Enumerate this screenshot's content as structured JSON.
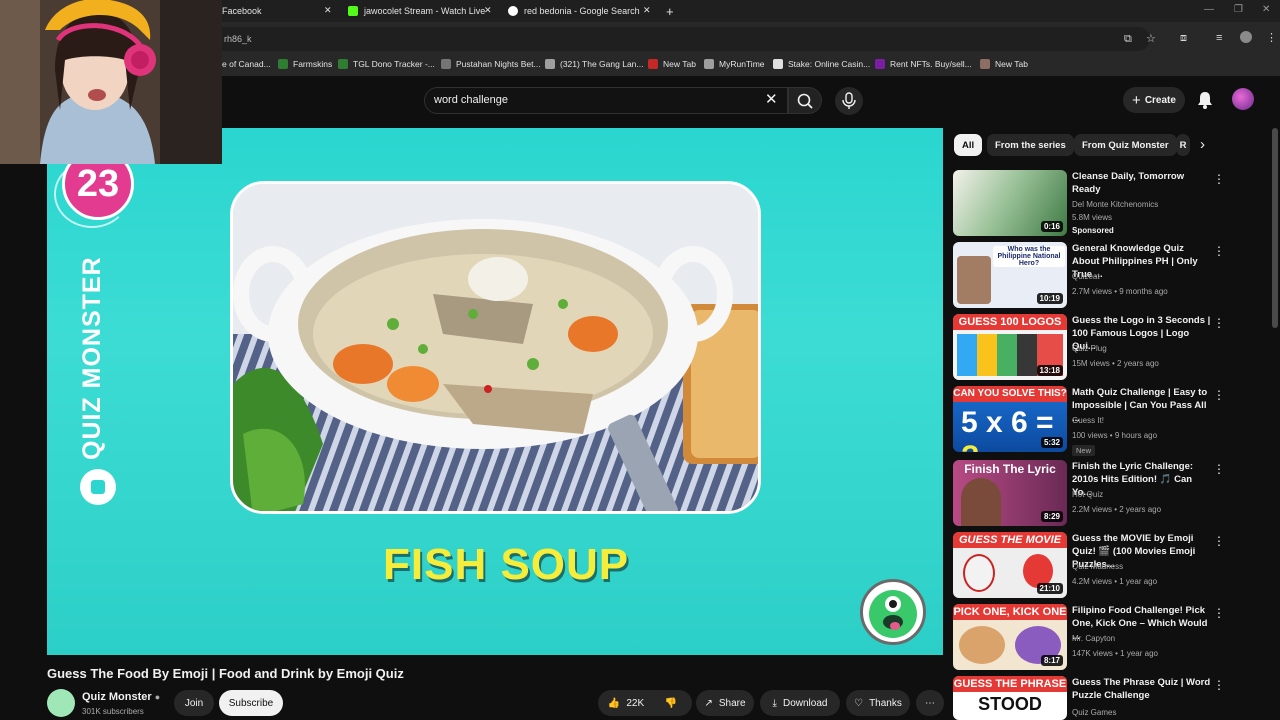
{
  "browser": {
    "tabs": [
      {
        "title": "Facebook",
        "color": "#1877f2"
      },
      {
        "title": "jawocolet Stream - Watch Live",
        "color": "#53fc18"
      },
      {
        "title": "red bedonia - Google Search",
        "color": "#4285f4"
      }
    ],
    "address": "rh86_k",
    "bookmarks": [
      {
        "label": "e of Canad...",
        "color": "#d32f2f"
      },
      {
        "label": "Farmskins",
        "color": "#2e7d32"
      },
      {
        "label": "TGL Dono Tracker -...",
        "color": "#2e7d32"
      },
      {
        "label": "Pustahan Nights Bet...",
        "color": "#757575"
      },
      {
        "label": "(321) The Gang Lan...",
        "color": "#9e9e9e"
      },
      {
        "label": "New Tab",
        "color": "#c62828"
      },
      {
        "label": "MyRunTime",
        "color": "#9e9e9e"
      },
      {
        "label": "Stake: Online Casin...",
        "color": "#e0e0e0"
      },
      {
        "label": "Rent NFTs. Buy/sell...",
        "color": "#7b1fa2"
      },
      {
        "label": "New Tab",
        "color": "#8d6e63"
      }
    ]
  },
  "youtube": {
    "search_query": "word challenge",
    "create_label": "Create",
    "player": {
      "question_number": "23",
      "brand_vertical": "QUIZ MONSTER",
      "answer_text": "FISH SOUP"
    },
    "video": {
      "title": "Guess The Food By Emoji | Food and Drink by Emoji Quiz",
      "channel": "Quiz Monster",
      "subscribers": "301K subscribers",
      "join_label": "Join",
      "subscribe_label": "Subscribe",
      "likes": "22K",
      "share_label": "Share",
      "download_label": "Download",
      "thanks_label": "Thanks"
    },
    "chips": [
      "All",
      "From the series",
      "From Quiz Monster",
      "R"
    ],
    "recommendations": [
      {
        "title": "Cleanse Daily, Tomorrow Ready",
        "channel": "Del Monte Kitchenomics",
        "meta": "5.8M views",
        "extra": "Sponsored",
        "duration": "0:16",
        "caption": "",
        "bg": "#7aa07c"
      },
      {
        "title": "General Knowledge Quiz About Philippines PH | Only True ...",
        "channel": "Quizeat",
        "meta": "2.7M views • 9 months ago",
        "extra": "",
        "duration": "10:19",
        "caption": "Who was the Philippine National Hero?",
        "bg": "#e9edf5"
      },
      {
        "title": "Guess the Logo in 3 Seconds | 100 Famous Logos | Logo Qui...",
        "channel": "Quiz Plug",
        "meta": "15M views • 2 years ago",
        "extra": "",
        "duration": "13:18",
        "caption": "GUESS 100 LOGOS",
        "bg": "#f4f4f4"
      },
      {
        "title": "Math Quiz Challenge | Easy to Impossible | Can You Pass All ...",
        "channel": "Guess It!",
        "meta": "100 views • 9 hours ago",
        "extra": "New",
        "duration": "5:32",
        "caption": "CAN YOU SOLVE THIS?",
        "bg": "#1a6fd1"
      },
      {
        "title": "Finish the Lyric Challenge: 2010s Hits Edition! 🎵 Can Yo...",
        "channel": "Hot Quiz",
        "meta": "2.2M views • 2 years ago",
        "extra": "",
        "duration": "8:29",
        "caption": "Finish The Lyric",
        "bg": "#b84b85"
      },
      {
        "title": "Guess the MOVIE by Emoji Quiz! 🎬 (100 Movies Emoji Puzzles...",
        "channel": "Quiz Madness",
        "meta": "4.2M views • 1 year ago",
        "extra": "",
        "duration": "21:10",
        "caption": "GUESS THE MOVIE",
        "bg": "#eeeeee"
      },
      {
        "title": "Filipino Food Challenge! Pick One, Kick One – Which Would ...",
        "channel": "Mr. Capyton",
        "meta": "147K views • 1 year ago",
        "extra": "",
        "duration": "8:17",
        "caption": "PICK ONE, KICK ONE",
        "bg": "#f3e6d0"
      },
      {
        "title": "Guess The Phrase Quiz | Word Puzzle Challenge",
        "channel": "Quiz Games",
        "meta": "",
        "extra": "",
        "duration": "",
        "caption": "GUESS THE PHRASE",
        "bg": "#ffffff"
      }
    ]
  }
}
